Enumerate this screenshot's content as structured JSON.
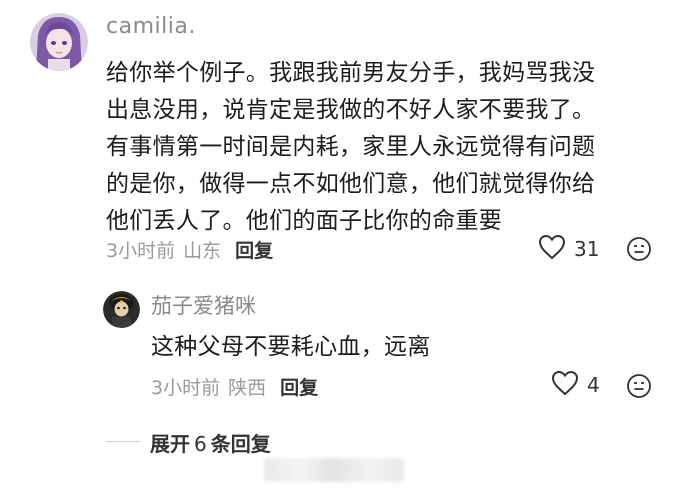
{
  "comment": {
    "username": "camilia.",
    "text": "给你举个例子。我跟我前男友分手，我妈骂我没\n出息没用，说肯定是我做的不好人家不要我了。\n有事情第一时间是内耗，家里人永远觉得有问题\n的是你，做得一点不如他们意，他们就觉得你给\n他们丢人了。他们的面子比你的命重要",
    "time": "3小时前",
    "location": "山东",
    "reply_label": "回复",
    "likes": "31",
    "like_icon": "heart-outline-icon",
    "emoji_icon": "smiley-face-icon"
  },
  "reply": {
    "username": "茄子爱猪咪",
    "text": "这种父母不要耗心血，远离",
    "time": "3小时前",
    "location": "陕西",
    "reply_label": "回复",
    "likes": "4"
  },
  "expand": {
    "prefix": "展开",
    "count": "6",
    "suffix": "条回复"
  },
  "colors": {
    "meta_text": "#9a9a9a",
    "username": "#8a8a8a",
    "body_text": "#1c1c1c"
  }
}
